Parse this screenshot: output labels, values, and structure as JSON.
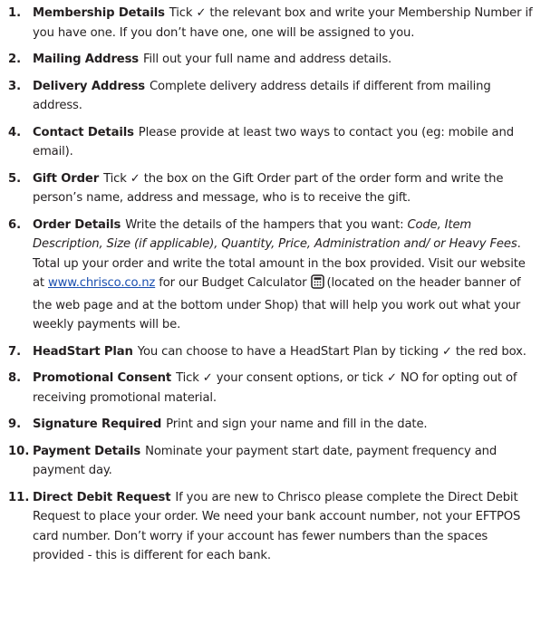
{
  "items": [
    {
      "number": "1.",
      "heading": "Membership Details",
      "parts": [
        "Tick",
        "✓",
        "the relevant box and write your Membership Number if you have one. If you don’t have one, one will be assigned to you."
      ]
    },
    {
      "number": "2.",
      "heading": "Mailing Address",
      "text": "Fill out your full name and address details."
    },
    {
      "number": "3.",
      "heading": "Delivery Address",
      "text": "Complete delivery address details if different from mailing address."
    },
    {
      "number": "4.",
      "heading": "Contact Details",
      "text": "Please provide at least two ways to contact you (eg: mobile and email)."
    },
    {
      "number": "5.",
      "heading": "Gift Order",
      "parts": [
        "Tick",
        "✓",
        "the box on the Gift Order part of the order form and write the person’s name, address and message, who is to receive the gift."
      ]
    },
    {
      "number": "6.",
      "heading": "Order Details",
      "text_a": "Write the details of the hampers that you want:",
      "italic": "Code, Item Description, Size (if applicable), Quantity, Price, Administration and/ or Heavy Fees",
      "text_b": ". Total up your order and write the total amount in the box provided. Visit our website at",
      "link": "www.chrisco.co.nz",
      "text_c": "for our Budget Calculator",
      "icon": "calculator-icon",
      "text_d": "(located on the header banner of the web page and at the bottom under Shop) that will help you work out what your weekly payments will be."
    },
    {
      "number": "7.",
      "heading": "HeadStart Plan",
      "parts": [
        "You can choose to have a HeadStart Plan by ticking",
        "✓",
        "the red box."
      ]
    },
    {
      "number": "8.",
      "heading": "Promotional Consent",
      "parts5": [
        "Tick",
        "✓",
        "your consent options, or tick",
        "✓",
        "NO for opting out of receiving promotional material."
      ]
    },
    {
      "number": "9.",
      "heading": "Signature Required",
      "text": "Print and sign your name and fill in the date."
    },
    {
      "number": "10.",
      "heading": "Payment Details",
      "text": "Nominate your payment start date, payment frequency and payment day."
    },
    {
      "number": "11.",
      "heading": "Direct Debit Request",
      "text": "If you are new to Chrisco please complete the Direct Debit Request to place your order. We need your bank account number, not your EFTPOS card number. Don’t worry if your account has fewer numbers than the spaces provided - this is different for each bank."
    }
  ]
}
